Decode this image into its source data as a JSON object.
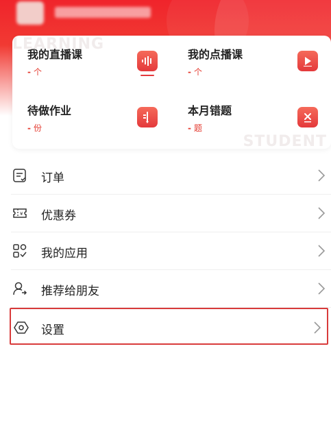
{
  "stats": [
    {
      "title": "我的直播课",
      "dash": "-",
      "unit": "个",
      "icon": "live-audio-icon"
    },
    {
      "title": "我的点播课",
      "dash": "-",
      "unit": "个",
      "icon": "play-icon"
    },
    {
      "title": "待做作业",
      "dash": "-",
      "unit": "份",
      "icon": "homework-icon"
    },
    {
      "title": "本月错题",
      "dash": "-",
      "unit": "题",
      "icon": "wrong-question-icon"
    }
  ],
  "watermarks": {
    "top": "LEARNING",
    "bottom": "STUDENT"
  },
  "menu": [
    {
      "label": "订单",
      "icon": "order-icon"
    },
    {
      "label": "优惠券",
      "icon": "coupon-icon"
    },
    {
      "label": "我的应用",
      "icon": "apps-icon"
    },
    {
      "label": "推荐给朋友",
      "icon": "share-user-icon"
    },
    {
      "label": "设置",
      "icon": "settings-icon"
    }
  ],
  "colors": {
    "accent": "#e4393c",
    "highlight_border": "#d83a3a"
  }
}
